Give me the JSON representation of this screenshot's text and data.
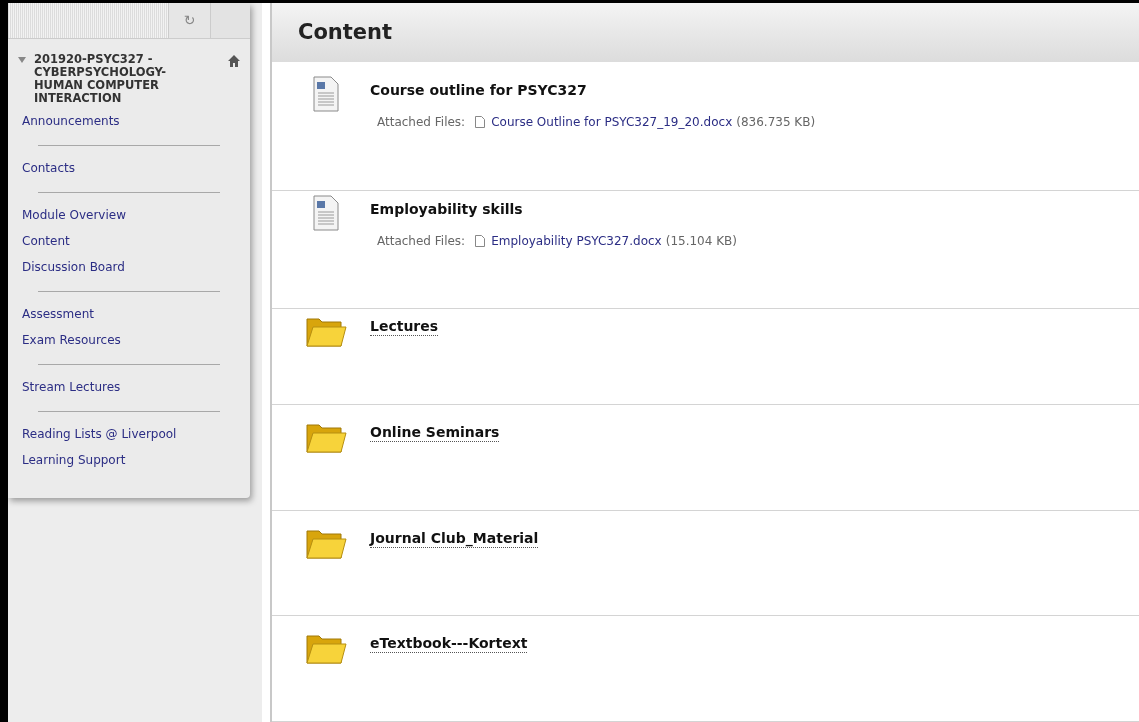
{
  "course_menu": {
    "refresh_button": "↻",
    "course_title": "201920-PSYC327 - CYBERPSYCHOLOGY-HUMAN COMPUTER INTERACTION",
    "expanded": true,
    "groups": [
      [
        "Announcements"
      ],
      [
        "Contacts"
      ],
      [
        "Module Overview",
        "Content",
        "Discussion Board"
      ],
      [
        "Assessment",
        "Exam Resources"
      ],
      [
        "Stream Lectures"
      ],
      [
        "Reading Lists @ Liverpool",
        "Learning Support"
      ]
    ]
  },
  "content": {
    "title": "Content",
    "items": [
      {
        "kind": "document",
        "title": "Course outline for PSYC327",
        "attached_label": "Attached Files:",
        "file_name": "Course Outline for PSYC327_19_20.docx",
        "file_size": "(836.735 KB)"
      },
      {
        "kind": "document",
        "title": "Employability skills",
        "attached_label": "Attached Files:",
        "file_name": "Employability PSYC327.docx",
        "file_size": "(15.104 KB)"
      },
      {
        "kind": "folder",
        "title": "Lectures"
      },
      {
        "kind": "folder",
        "title": "Online Seminars"
      },
      {
        "kind": "folder",
        "title": "Journal Club_Material"
      },
      {
        "kind": "folder",
        "title": "eTextbook---Kortext"
      }
    ]
  }
}
